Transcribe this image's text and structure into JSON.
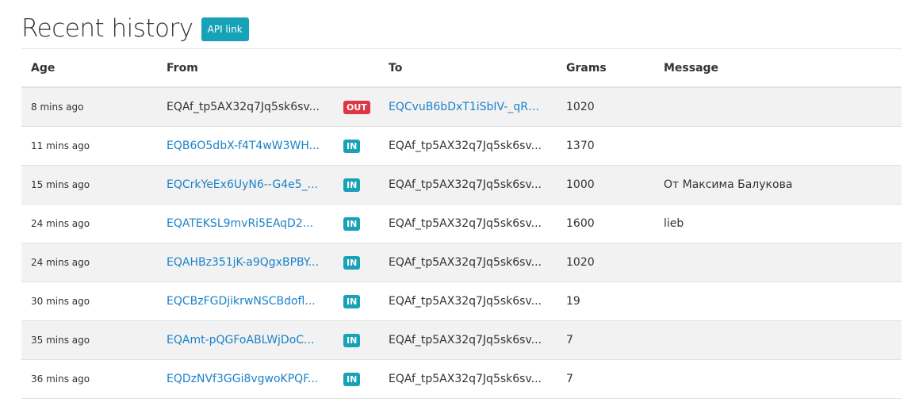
{
  "header": {
    "title": "Recent history",
    "api_link_label": "API link"
  },
  "table": {
    "columns": {
      "age": "Age",
      "from": "From",
      "to": "To",
      "grams": "Grams",
      "message": "Message"
    },
    "rows": [
      {
        "age": "8 mins ago",
        "from": "EQAf_tp5AX32q7Jq5sk6sv...",
        "direction": "OUT",
        "to": "EQCvuB6bDxT1iSbIV-_qRh...",
        "grams": "1020",
        "message": ""
      },
      {
        "age": "11 mins ago",
        "from": "EQB6O5dbX-f4T4wW3WH...",
        "direction": "IN",
        "to": "EQAf_tp5AX32q7Jq5sk6sv...",
        "grams": "1370",
        "message": ""
      },
      {
        "age": "15 mins ago",
        "from": "EQCrkYeEx6UyN6--G4e5_...",
        "direction": "IN",
        "to": "EQAf_tp5AX32q7Jq5sk6sv...",
        "grams": "1000",
        "message": "От Максима Балукова"
      },
      {
        "age": "24 mins ago",
        "from": "EQATEKSL9mvRi5EAqD2...",
        "direction": "IN",
        "to": "EQAf_tp5AX32q7Jq5sk6sv...",
        "grams": "1600",
        "message": "lieb"
      },
      {
        "age": "24 mins ago",
        "from": "EQAHBz351jK-a9QgxBPBY...",
        "direction": "IN",
        "to": "EQAf_tp5AX32q7Jq5sk6sv...",
        "grams": "1020",
        "message": ""
      },
      {
        "age": "30 mins ago",
        "from": "EQCBzFGDjikrwNSCBdofl...",
        "direction": "IN",
        "to": "EQAf_tp5AX32q7Jq5sk6sv...",
        "grams": "19",
        "message": ""
      },
      {
        "age": "35 mins ago",
        "from": "EQAmt-pQGFoABLWjDoC...",
        "direction": "IN",
        "to": "EQAf_tp5AX32q7Jq5sk6sv...",
        "grams": "7",
        "message": ""
      },
      {
        "age": "36 mins ago",
        "from": "EQDzNVf3GGi8vgwoKPQF...",
        "direction": "IN",
        "to": "EQAf_tp5AX32q7Jq5sk6sv...",
        "grams": "7",
        "message": ""
      }
    ]
  },
  "colors": {
    "link": "#1a82c9",
    "badge_in": "#17a2b8",
    "badge_out": "#dc3545",
    "api_button": "#17a2b8",
    "stripe": "#f2f2f2"
  }
}
